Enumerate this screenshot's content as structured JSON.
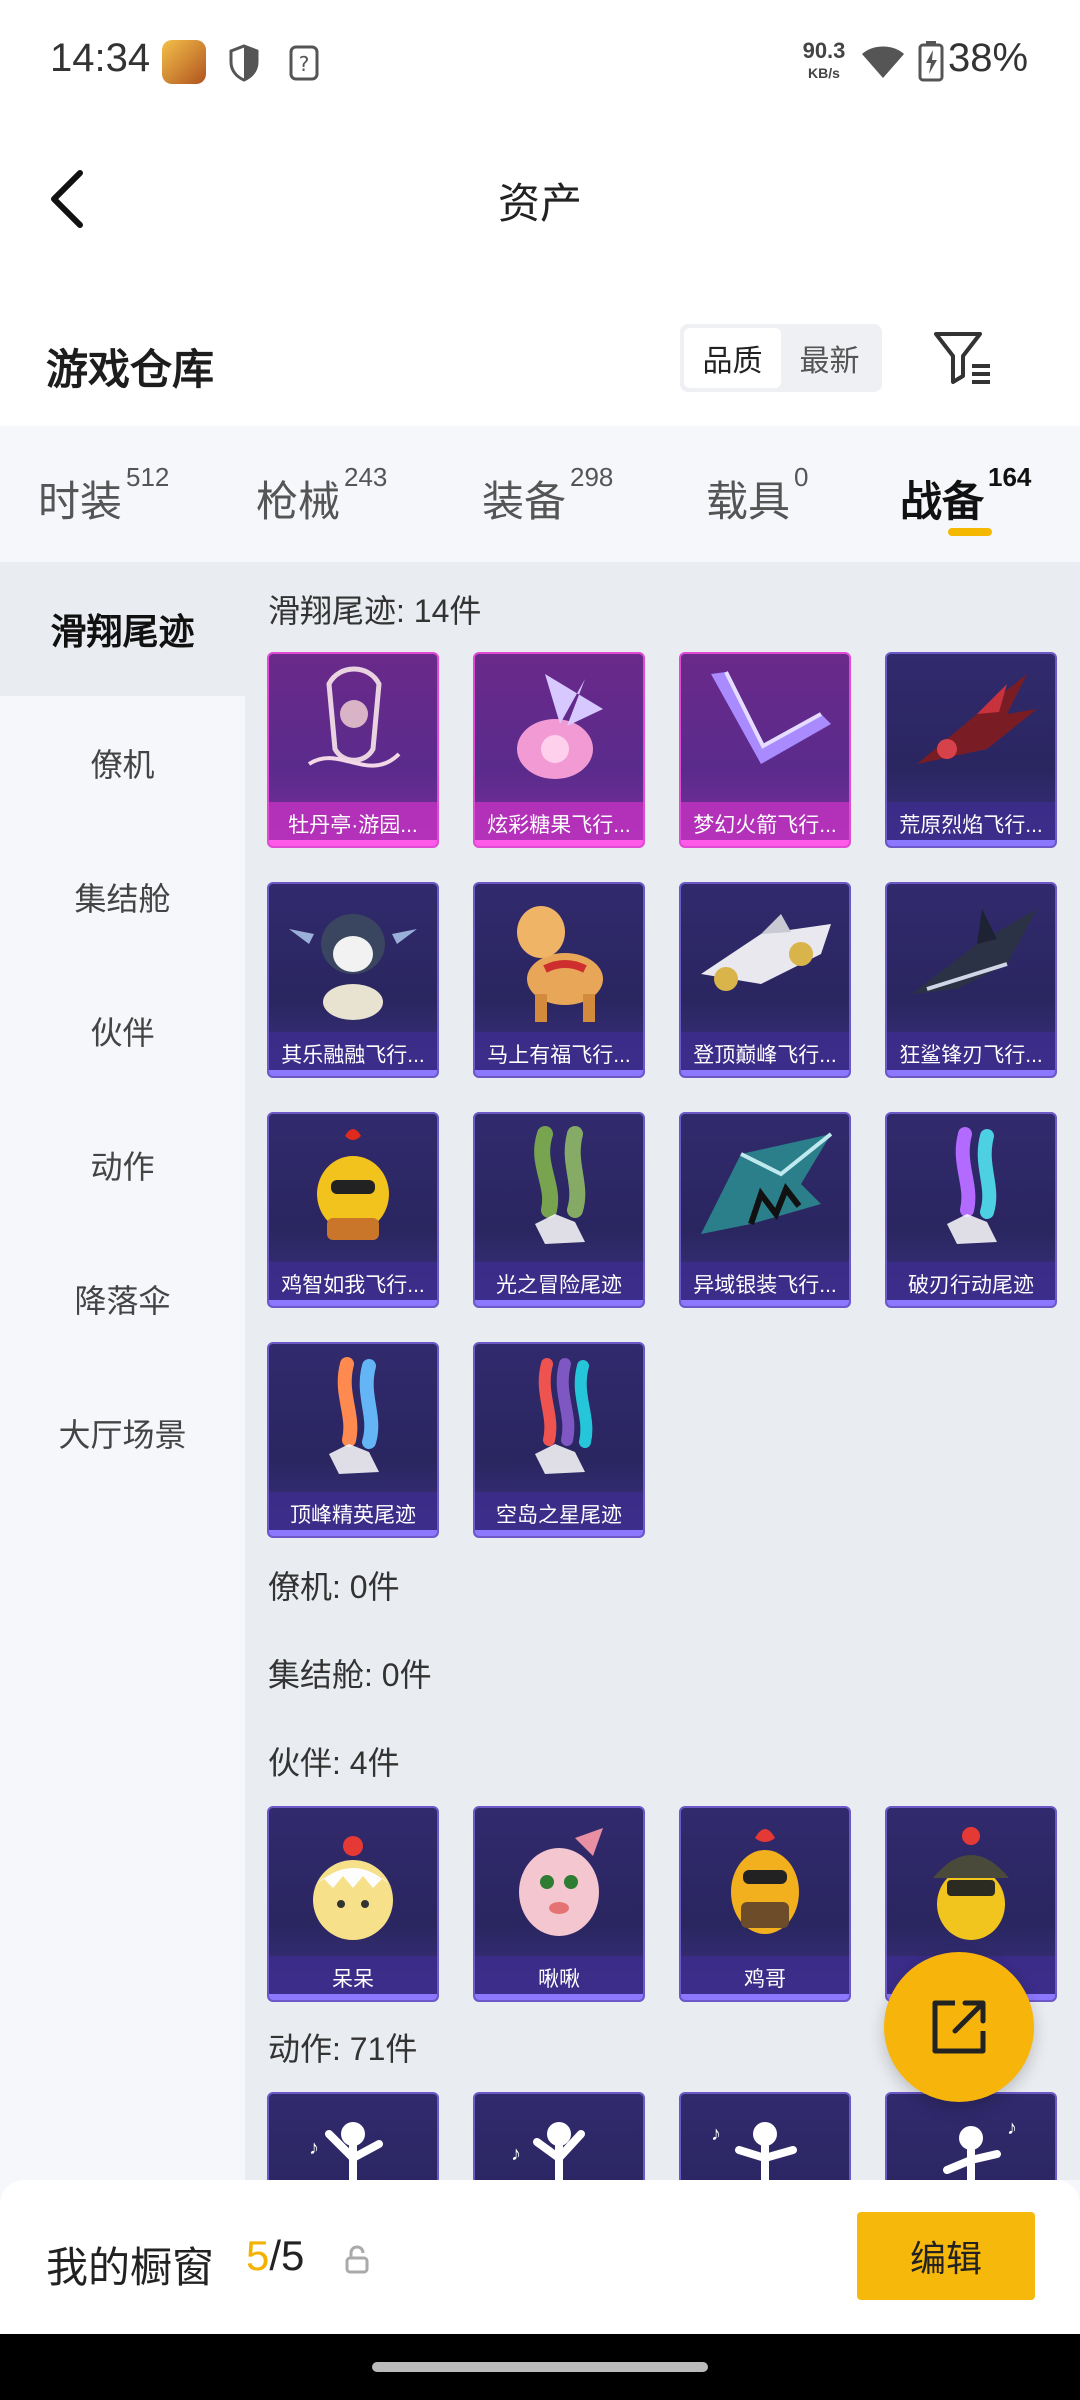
{
  "status_bar": {
    "time": "14:34",
    "speed_value": "90.3",
    "speed_unit": "KB/s",
    "battery": "38%",
    "icons": [
      "app-icon",
      "shield-icon",
      "question-icon",
      "wifi-icon",
      "battery-icon"
    ]
  },
  "header": {
    "title": "资产",
    "back_icon": "chevron-left-icon"
  },
  "section": {
    "title": "游戏仓库",
    "sort_options": [
      "品质",
      "最新"
    ],
    "sort_selected": "品质",
    "filter_icon": "filter-icon"
  },
  "tabs": [
    {
      "label": "时装",
      "count": "512"
    },
    {
      "label": "枪械",
      "count": "243"
    },
    {
      "label": "装备",
      "count": "298"
    },
    {
      "label": "载具",
      "count": "0"
    },
    {
      "label": "战备",
      "count": "164",
      "active": true
    }
  ],
  "sidebar": [
    {
      "label": "滑翔尾迹",
      "active": true
    },
    {
      "label": "僚机"
    },
    {
      "label": "集结舱"
    },
    {
      "label": "伙伴"
    },
    {
      "label": "动作"
    },
    {
      "label": "降落伞"
    },
    {
      "label": "大厅场景"
    }
  ],
  "categories": {
    "glide": {
      "title": "滑翔尾迹: 14件",
      "items": [
        {
          "name": "牡丹亭·游园...",
          "rarity": "pink",
          "icon": "lantern-icon"
        },
        {
          "name": "炫彩糖果飞行...",
          "rarity": "pink",
          "icon": "candy-icon"
        },
        {
          "name": "梦幻火箭飞行...",
          "rarity": "pink",
          "icon": "rocket-icon"
        },
        {
          "name": "荒原烈焰飞行...",
          "rarity": "purple",
          "icon": "flame-glider-icon"
        },
        {
          "name": "其乐融融飞行...",
          "rarity": "purple",
          "icon": "penguin-icon"
        },
        {
          "name": "马上有福飞行...",
          "rarity": "purple",
          "icon": "horse-icon"
        },
        {
          "name": "登顶巅峰飞行...",
          "rarity": "purple",
          "icon": "jet-icon"
        },
        {
          "name": "狂鲨锋刃飞行...",
          "rarity": "purple",
          "icon": "shark-icon"
        },
        {
          "name": "鸡智如我飞行...",
          "rarity": "purple",
          "icon": "chicken-icon"
        },
        {
          "name": "光之冒险尾迹",
          "rarity": "purple",
          "icon": "trail-green-icon"
        },
        {
          "name": "异域银装飞行...",
          "rarity": "purple",
          "icon": "wing-icon"
        },
        {
          "name": "破刃行动尾迹",
          "rarity": "purple",
          "icon": "trail-rainbow-icon"
        },
        {
          "name": "顶峰精英尾迹",
          "rarity": "purple",
          "icon": "trail-fire-icon"
        },
        {
          "name": "空岛之星尾迹",
          "rarity": "purple",
          "icon": "trail-multi-icon"
        }
      ]
    },
    "wingman": {
      "title": "僚机: 0件"
    },
    "pod": {
      "title": "集结舱: 0件"
    },
    "partner": {
      "title": "伙伴: 4件",
      "items": [
        {
          "name": "呆呆",
          "rarity": "purple",
          "icon": "chick-egg-icon"
        },
        {
          "name": "啾啾",
          "rarity": "purple",
          "icon": "pink-bird-icon"
        },
        {
          "name": "鸡哥",
          "rarity": "purple",
          "icon": "rooster-icon"
        },
        {
          "name": "",
          "rarity": "purple",
          "icon": "helmet-chicken-icon"
        }
      ]
    },
    "emote": {
      "title": "动作: 71件"
    }
  },
  "fab": {
    "icon": "share-icon"
  },
  "bottom": {
    "label": "我的橱窗",
    "count_current": "5",
    "count_sep": "/",
    "count_total": "5",
    "lock_icon": "lock-icon",
    "edit_label": "编辑"
  },
  "colors": {
    "accent": "#f7b80c",
    "pink_card": "#e04bd6",
    "purple_card": "#6d58c8"
  }
}
